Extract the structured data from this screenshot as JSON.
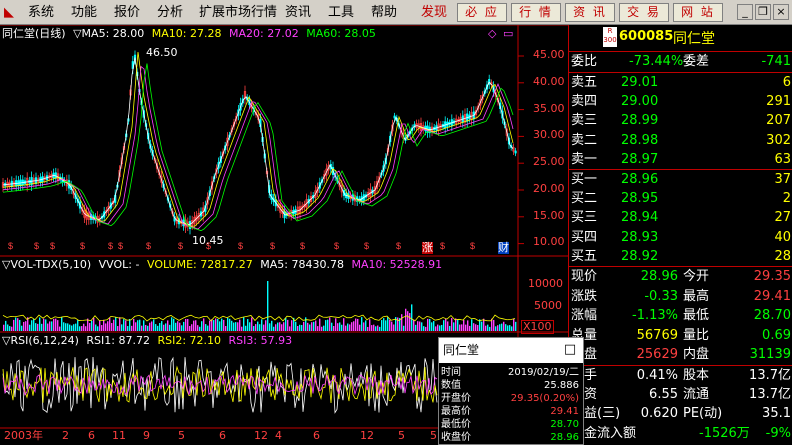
{
  "menu": {
    "items": [
      "系统",
      "功能",
      "报价",
      "分析",
      "扩展市场行情",
      "资讯",
      "工具",
      "帮助"
    ],
    "discover": "发现",
    "buttons": [
      "必 应",
      "行 情",
      "资 讯",
      "交 易",
      "网 站"
    ]
  },
  "chart": {
    "title": "同仁堂(日线)",
    "ma_caption": [
      {
        "text": "▽MA5: 28.00",
        "color": "#ffffff"
      },
      {
        "text": "MA10: 27.28",
        "color": "#ffff00"
      },
      {
        "text": "MA20: 27.02",
        "color": "#ff40ff"
      },
      {
        "text": "MA60: 28.05",
        "color": "#00ff00"
      }
    ],
    "price_axis": [
      "45.00",
      "40.00",
      "35.00",
      "30.00",
      "25.00",
      "20.00",
      "15.00",
      "10.00"
    ],
    "high_label": "46.50",
    "low_label": "10.45",
    "marker_zhang": "涨",
    "marker_cai": "财",
    "vol_caption": [
      {
        "text": "▽VOL-TDX(5,10)",
        "color": "#ffffff"
      },
      {
        "text": "VVOL: -",
        "color": "#ffffff"
      },
      {
        "text": "VOLUME: 72817.27",
        "color": "#ffff00"
      },
      {
        "text": "MA5: 78430.78",
        "color": "#ffffff"
      },
      {
        "text": "MA10: 52528.91",
        "color": "#ff40ff"
      }
    ],
    "vol_axis": [
      "10000",
      "5000"
    ],
    "vol_unit": "X100",
    "rsi_caption": [
      {
        "text": "▽RSI(6,12,24)",
        "color": "#ffffff"
      },
      {
        "text": "RSI1: 87.72",
        "color": "#ffffff"
      },
      {
        "text": "RSI2: 72.10",
        "color": "#ffff00"
      },
      {
        "text": "RSI3: 57.93",
        "color": "#ff40ff"
      }
    ],
    "time_axis": [
      "2003年",
      "2",
      "6",
      "11",
      "9",
      "5",
      "6",
      "12",
      "4",
      "6",
      "12",
      "5",
      "5",
      "6"
    ]
  },
  "panel": {
    "badge_top": "R",
    "badge_bottom": "300",
    "code": "600085",
    "name": "同仁堂",
    "weibi_label": "委比",
    "weibi_value": "-73.44%",
    "weicha_label": "委差",
    "weicha_value": "-741",
    "sells": [
      {
        "label": "卖五",
        "price": "29.01",
        "vol": "6"
      },
      {
        "label": "卖四",
        "price": "29.00",
        "vol": "291"
      },
      {
        "label": "卖三",
        "price": "28.99",
        "vol": "207"
      },
      {
        "label": "卖二",
        "price": "28.98",
        "vol": "302"
      },
      {
        "label": "卖一",
        "price": "28.97",
        "vol": "63"
      }
    ],
    "buys": [
      {
        "label": "买一",
        "price": "28.96",
        "vol": "37"
      },
      {
        "label": "买二",
        "price": "28.95",
        "vol": "2"
      },
      {
        "label": "买三",
        "price": "28.94",
        "vol": "27"
      },
      {
        "label": "买四",
        "price": "28.93",
        "vol": "40"
      },
      {
        "label": "买五",
        "price": "28.92",
        "vol": "28"
      }
    ],
    "stats": [
      {
        "l1": "现价",
        "v1": "28.96",
        "c1": "#00ff00",
        "l2": "今开",
        "v2": "29.35",
        "c2": "#ff4040"
      },
      {
        "l1": "涨跌",
        "v1": "-0.33",
        "c1": "#00ff00",
        "l2": "最高",
        "v2": "29.41",
        "c2": "#ff4040"
      },
      {
        "l1": "涨幅",
        "v1": "-1.13%",
        "c1": "#00ff00",
        "l2": "最低",
        "v2": "28.70",
        "c2": "#00ff00"
      },
      {
        "l1": "总量",
        "v1": "56769",
        "c1": "#ffff00",
        "l2": "量比",
        "v2": "0.69",
        "c2": "#00ff00"
      },
      {
        "l1": "外盘",
        "v1": "25629",
        "c1": "#ff4040",
        "l2": "内盘",
        "v2": "31139",
        "c2": "#00ff00"
      }
    ],
    "extra": [
      {
        "l1": "换手",
        "v1": "0.41%",
        "c1": "#ffffff",
        "l2": "股本",
        "v2": "13.7亿",
        "c2": "#ffffff"
      },
      {
        "l1": "净资",
        "v1": "6.55",
        "c1": "#ffffff",
        "l2": "流通",
        "v2": "13.7亿",
        "c2": "#ffffff"
      },
      {
        "l1": "收益(三)",
        "v1": "0.620",
        "c1": "#ffffff",
        "l2": "PE(动)",
        "v2": "35.1",
        "c2": "#ffffff"
      }
    ],
    "flow_label": "资金流入额",
    "flow_value": "-1526万",
    "flow_pct": "-9%"
  },
  "popup": {
    "title": "同仁堂",
    "rows": [
      {
        "label": "时间",
        "value": "2019/02/19/二",
        "color": "#ffffff"
      },
      {
        "label": "数值",
        "value": "25.886",
        "color": "#ffffff"
      },
      {
        "label": "开盘价",
        "value": "29.35(0.20%)",
        "color": "#ff4040"
      },
      {
        "label": "最高价",
        "value": "29.41",
        "color": "#ff4040"
      },
      {
        "label": "最低价",
        "value": "28.70",
        "color": "#00ff00"
      },
      {
        "label": "收盘价",
        "value": "28.96",
        "color": "#00ff00"
      }
    ]
  }
}
